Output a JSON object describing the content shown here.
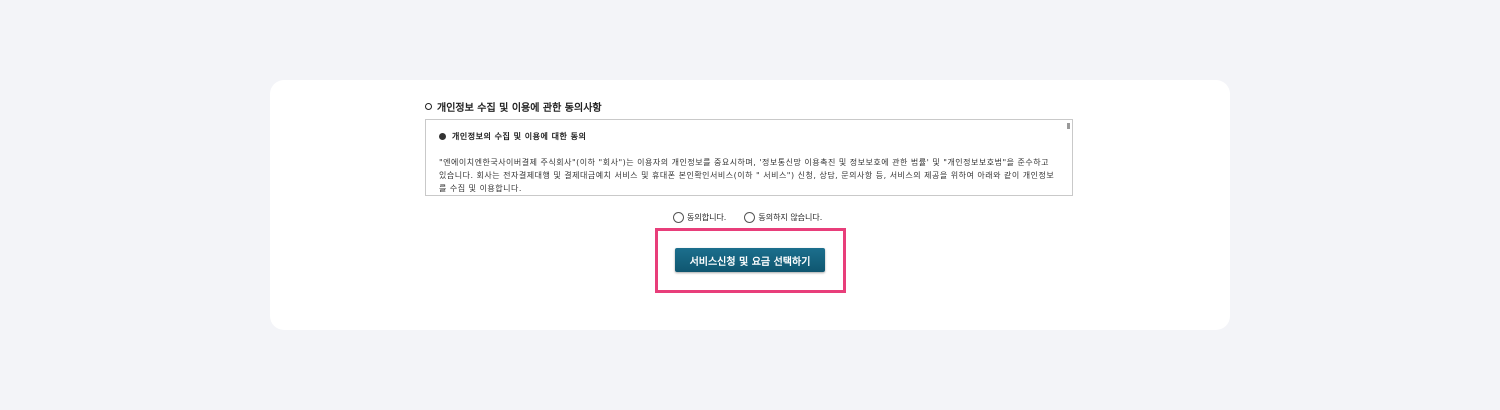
{
  "consent": {
    "section_title": "개인정보 수집 및 이용에 관한 동의사항",
    "terms_heading": "개인정보의 수집 및 이용에 대한 동의",
    "terms_body": "\"엔에이치엔한국사이버결제 주식회사\"(이하 \"회사\")는 이용자의 개인정보를 중요시하며, '정보통신망 이용촉진 및 정보보호에 관한 법률' 및 \"개인정보보호법\"을 준수하고 있습니다. 회사는 전자결제대행 및 결제대금예치 서비스 및 휴대폰 본인확인서비스(이하 \" 서비스\") 신청, 상담, 문의사항 등, 서비스의 제공을 위하여 아래와 같이 개인정보를 수집 및 이용합니다.",
    "agree_label": "동의합니다.",
    "disagree_label": "동의하지 않습니다."
  },
  "actions": {
    "submit_label": "서비스신청 및 요금 선택하기"
  },
  "colors": {
    "page_background": "#f3f4f8",
    "card_background": "#ffffff",
    "button_background": "#136282",
    "highlight_border": "#e83e7a"
  },
  "icons": {
    "section_bullet": "circle-bullet-icon",
    "terms_bullet": "filled-dot-icon",
    "radio": "radio-icon"
  }
}
